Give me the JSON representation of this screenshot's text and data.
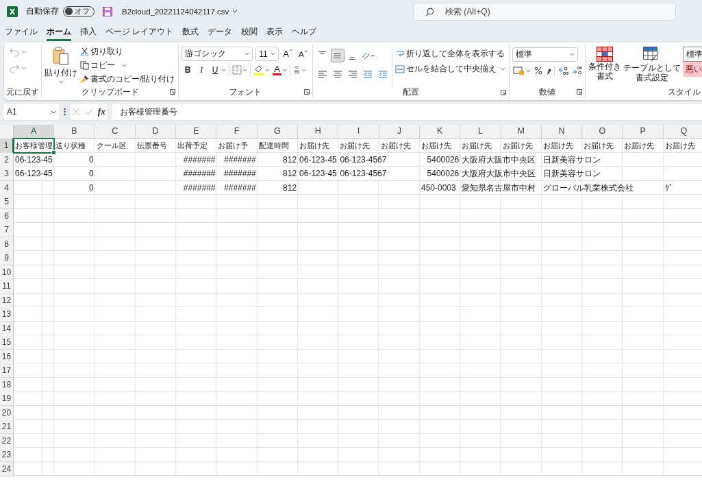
{
  "title_bar": {
    "autosave_label": "自動保存",
    "autosave": {
      "label": "オフ",
      "on": false
    },
    "filename": "B2cloud_20221124042117.csv",
    "search": {
      "placeholder": "検索 (Alt+Q)"
    }
  },
  "menu_tabs": [
    {
      "label": "ファイル",
      "selected": false
    },
    {
      "label": "ホーム",
      "selected": true
    },
    {
      "label": "挿入",
      "selected": false
    },
    {
      "label": "ページ レイアウト",
      "selected": false
    },
    {
      "label": "数式",
      "selected": false
    },
    {
      "label": "データ",
      "selected": false
    },
    {
      "label": "校閲",
      "selected": false
    },
    {
      "label": "表示",
      "selected": false
    },
    {
      "label": "ヘルプ",
      "selected": false
    }
  ],
  "ribbon": {
    "undo": {
      "label": "元に戻す",
      "undo_disabled": true,
      "redo_disabled": true
    },
    "clipboard": {
      "label": "クリップボード",
      "paste": "貼り付け",
      "cut": "切り取り",
      "copy": "コピー",
      "format_painter": "書式のコピー/貼り付け"
    },
    "font": {
      "label": "フォント",
      "name": "游ゴシック",
      "size": "11",
      "grow": "A",
      "shrink": "A",
      "bold": "B",
      "italic": "I",
      "underline": "U",
      "font_color": "A"
    },
    "alignment": {
      "label": "配置",
      "vertical": [
        {
          "kind": "top",
          "selected": false
        },
        {
          "kind": "middle",
          "selected": true
        },
        {
          "kind": "bottom",
          "selected": false
        }
      ],
      "wrap_text": "折り返して全体を表示する",
      "merge_center": "セルを結合して中央揃え"
    },
    "number": {
      "label": "数値",
      "format": "標準"
    },
    "styles": {
      "label": "スタイル",
      "conditional_formatting": [
        "条件付き",
        "書式"
      ],
      "format_as_table": [
        "テーブルとして",
        "書式設定"
      ],
      "cell_styles": [
        {
          "label": "標準",
          "kind": "normal"
        },
        {
          "label": "悪い",
          "kind": "bad"
        }
      ]
    }
  },
  "formula_bar": {
    "name_box": "A1",
    "function_label": "fx",
    "formula": "お客様管理番号"
  },
  "sheet": {
    "columns": [
      {
        "label": "A",
        "selected": true
      },
      {
        "label": "B",
        "selected": false
      },
      {
        "label": "C",
        "selected": false
      },
      {
        "label": "D",
        "selected": false
      },
      {
        "label": "E",
        "selected": false
      },
      {
        "label": "F",
        "selected": false
      },
      {
        "label": "G",
        "selected": false
      },
      {
        "label": "H",
        "selected": false
      },
      {
        "label": "I",
        "selected": false
      },
      {
        "label": "J",
        "selected": false
      },
      {
        "label": "K",
        "selected": false
      },
      {
        "label": "L",
        "selected": false
      },
      {
        "label": "M",
        "selected": false
      },
      {
        "label": "N",
        "selected": false
      },
      {
        "label": "O",
        "selected": false
      },
      {
        "label": "P",
        "selected": false
      },
      {
        "label": "Q",
        "selected": false
      }
    ],
    "rows": [
      {
        "number": "1",
        "selected": true,
        "cells": [
          {
            "text": "お客様管理",
            "kind": "text"
          },
          {
            "text": "送り状種",
            "kind": "text"
          },
          {
            "text": "クール区",
            "kind": "text"
          },
          {
            "text": "伝票番号",
            "kind": "text"
          },
          {
            "text": "出荷予定",
            "kind": "text"
          },
          {
            "text": "お届け予",
            "kind": "text"
          },
          {
            "text": "配達時間",
            "kind": "text"
          },
          {
            "text": "お届け先",
            "kind": "text"
          },
          {
            "text": "お届け先",
            "kind": "text"
          },
          {
            "text": "お届け先",
            "kind": "text"
          },
          {
            "text": "お届け先",
            "kind": "text"
          },
          {
            "text": "お届け先",
            "kind": "text"
          },
          {
            "text": "お届け先",
            "kind": "text"
          },
          {
            "text": "お届け先",
            "kind": "text"
          },
          {
            "text": "お届け先",
            "kind": "text"
          },
          {
            "text": "お届け先",
            "kind": "text"
          },
          {
            "text": "お届け先",
            "kind": "text"
          }
        ]
      },
      {
        "number": "2",
        "selected": false,
        "cells": [
          {
            "text": "06-123-45",
            "kind": "text"
          },
          {
            "text": "0",
            "kind": "number"
          },
          {},
          {},
          {
            "text": "#######",
            "kind": "number"
          },
          {
            "text": "#######",
            "kind": "number"
          },
          {
            "text": "812",
            "kind": "number"
          },
          {
            "text": "06-123-45",
            "kind": "text"
          },
          {
            "text": "06-123-4567",
            "kind": "text"
          },
          {},
          {
            "text": "5400026",
            "kind": "number"
          },
          {
            "text": "大阪府大阪市中央区",
            "kind": "text"
          },
          {},
          {
            "text": "日新美容サロン",
            "kind": "text"
          },
          {},
          {},
          {}
        ]
      },
      {
        "number": "3",
        "selected": false,
        "cells": [
          {
            "text": "06-123-45",
            "kind": "text"
          },
          {
            "text": "0",
            "kind": "number"
          },
          {},
          {},
          {
            "text": "#######",
            "kind": "number"
          },
          {
            "text": "#######",
            "kind": "number"
          },
          {
            "text": "812",
            "kind": "number"
          },
          {
            "text": "06-123-45",
            "kind": "text"
          },
          {
            "text": "06-123-4567",
            "kind": "text"
          },
          {},
          {
            "text": "5400026",
            "kind": "number"
          },
          {
            "text": "大阪府大阪市中央区",
            "kind": "text"
          },
          {},
          {
            "text": "日新美容サロン",
            "kind": "text"
          },
          {},
          {},
          {}
        ]
      },
      {
        "number": "4",
        "selected": false,
        "cells": [
          {},
          {
            "text": "0",
            "kind": "number"
          },
          {},
          {},
          {
            "text": "#######",
            "kind": "number"
          },
          {
            "text": "#######",
            "kind": "number"
          },
          {
            "text": "812",
            "kind": "number"
          },
          {},
          {},
          {},
          {
            "text": "450-0003",
            "kind": "text"
          },
          {
            "text": "愛知県名古屋市中村",
            "kind": "text"
          },
          {},
          {
            "text": "グローバル乳業株式会社",
            "kind": "text"
          },
          {},
          {},
          {
            "text": "ｸﾞ",
            "kind": "text"
          }
        ]
      },
      {
        "number": "5",
        "selected": false
      },
      {
        "number": "6",
        "selected": false
      },
      {
        "number": "7",
        "selected": false
      },
      {
        "number": "8",
        "selected": false
      },
      {
        "number": "9",
        "selected": false
      },
      {
        "number": "10",
        "selected": false
      },
      {
        "number": "11",
        "selected": false
      },
      {
        "number": "12",
        "selected": false
      },
      {
        "number": "13",
        "selected": false
      },
      {
        "number": "14",
        "selected": false
      },
      {
        "number": "15",
        "selected": false
      },
      {
        "number": "16",
        "selected": false
      },
      {
        "number": "17",
        "selected": false
      },
      {
        "number": "18",
        "selected": false
      },
      {
        "number": "19",
        "selected": false
      },
      {
        "number": "20",
        "selected": false
      },
      {
        "number": "21",
        "selected": false
      },
      {
        "number": "22",
        "selected": false
      },
      {
        "number": "23",
        "selected": false
      },
      {
        "number": "24",
        "selected": false
      }
    ]
  }
}
